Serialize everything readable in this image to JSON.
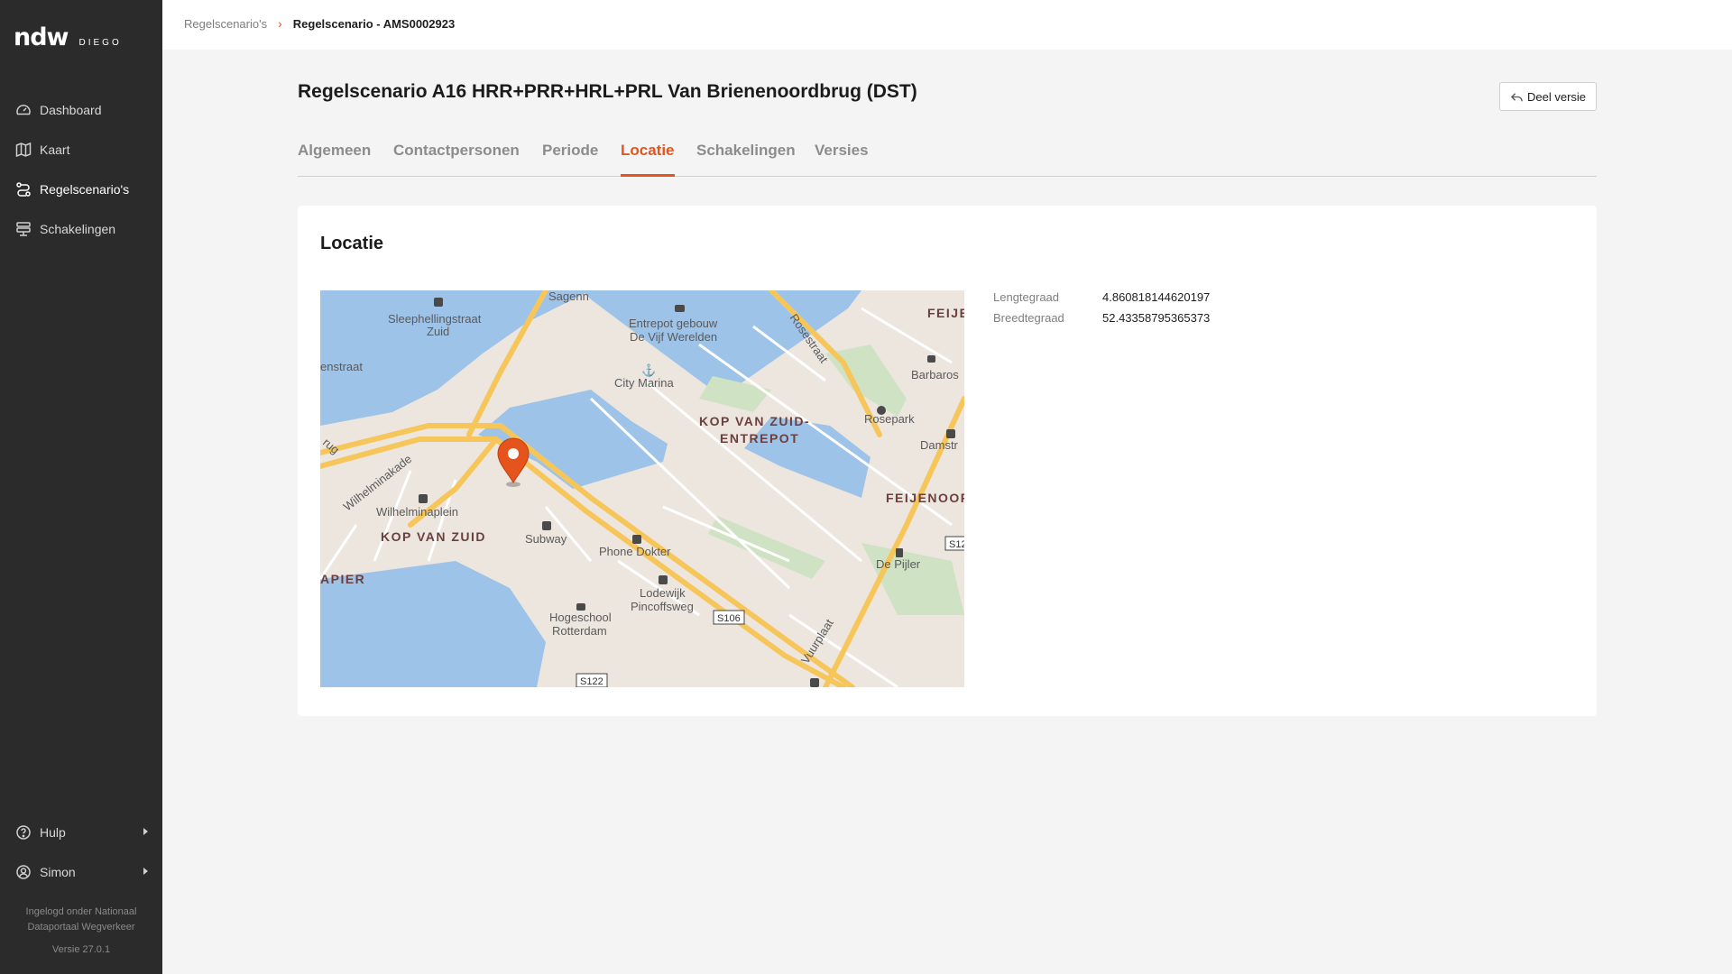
{
  "app": {
    "logo_main": "ndw",
    "logo_sub": "DIEGO"
  },
  "sidebar": {
    "items": [
      {
        "label": "Dashboard",
        "icon": "gauge-icon"
      },
      {
        "label": "Kaart",
        "icon": "map-icon"
      },
      {
        "label": "Regelscenario's",
        "icon": "route-icon",
        "active": true
      },
      {
        "label": "Schakelingen",
        "icon": "layers-icon"
      }
    ],
    "bottom": [
      {
        "label": "Hulp",
        "icon": "help-icon"
      },
      {
        "label": "Simon",
        "icon": "user-icon"
      }
    ],
    "footer_line1": "Ingelogd onder Nationaal",
    "footer_line2": "Dataportaal Wegverkeer",
    "version": "Versie 27.0.1"
  },
  "breadcrumb": {
    "parent": "Regelscenario's",
    "current": "Regelscenario - AMS0002923"
  },
  "page": {
    "title": "Regelscenario A16 HRR+PRR+HRL+PRL Van Brienenoordbrug (DST)",
    "share_label": "Deel versie"
  },
  "tabs": [
    {
      "label": "Algemeen"
    },
    {
      "label": "Contactpersonen"
    },
    {
      "label": "Periode"
    },
    {
      "label": "Locatie",
      "active": true
    },
    {
      "label": "Schakelingen"
    },
    {
      "label": "Versies"
    }
  ],
  "location": {
    "card_title": "Locatie",
    "longitude_label": "Lengtegraad",
    "longitude_value": "4.860818144620197",
    "latitude_label": "Breedtegraad",
    "latitude_value": "52.43358795365373"
  },
  "map": {
    "labels": {
      "sagenn": "Sagenn",
      "sleephellingstraat1": "Sleephellingstraat",
      "sleephellingstraat2": "Zuid",
      "enstraat": "enstraat",
      "entrepot1": "Entrepot gebouw",
      "entrepot2": "De Vijf Werelden",
      "city_marina": "City Marina",
      "rosestraat": "Rosestraat",
      "barbaros": "Barbaros",
      "feije": "FEIJE",
      "kop_entrepot1": "KOP VAN ZUID-",
      "kop_entrepot2": "ENTREPOT",
      "rosepark": "Rosepark",
      "damstr": "Damstr",
      "feijenoord": "FEIJENOOR",
      "wilhelminakade": "Wilhelminakade",
      "rug": "rug",
      "wilhelminaplein": "Wilhelminaplein",
      "kop_van_zuid": "KOP VAN ZUID",
      "subway": "Subway",
      "phone_dokter": "Phone Dokter",
      "de_pijler": "De Pijler",
      "s12": "S12",
      "apier": "APIER",
      "lodewijk1": "Lodewijk",
      "lodewijk2": "Pincoffsweg",
      "s106": "S106",
      "hogeschool1": "Hogeschool",
      "hogeschool2": "Rotterdam",
      "vuurplaat": "Vuurplaat",
      "s122": "S122"
    },
    "colors": {
      "land": "#ece6de",
      "water": "#9ec3e8",
      "road_major": "#f7c65a",
      "park": "#cfe3c4",
      "marker": "#e5541d"
    }
  }
}
